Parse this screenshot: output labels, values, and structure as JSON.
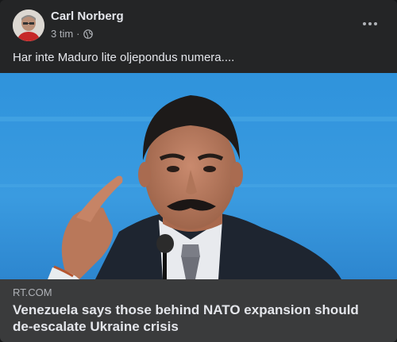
{
  "post": {
    "author": "Carl Norberg",
    "timestamp": "3 tim",
    "separator": "·",
    "privacy_icon": "globe-icon",
    "more_icon": "more-dots-icon",
    "text": "Har inte Maduro lite oljepondus numera...."
  },
  "link": {
    "domain": "RT.COM",
    "title": "Venezuela says those behind NATO expansion should de-escalate Ukraine crisis"
  },
  "colors": {
    "card_bg": "#242526",
    "footer_bg": "#3a3b3c",
    "primary_text": "#e4e6eb",
    "secondary_text": "#b0b3b8",
    "image_backdrop": "#2f8fd8"
  }
}
